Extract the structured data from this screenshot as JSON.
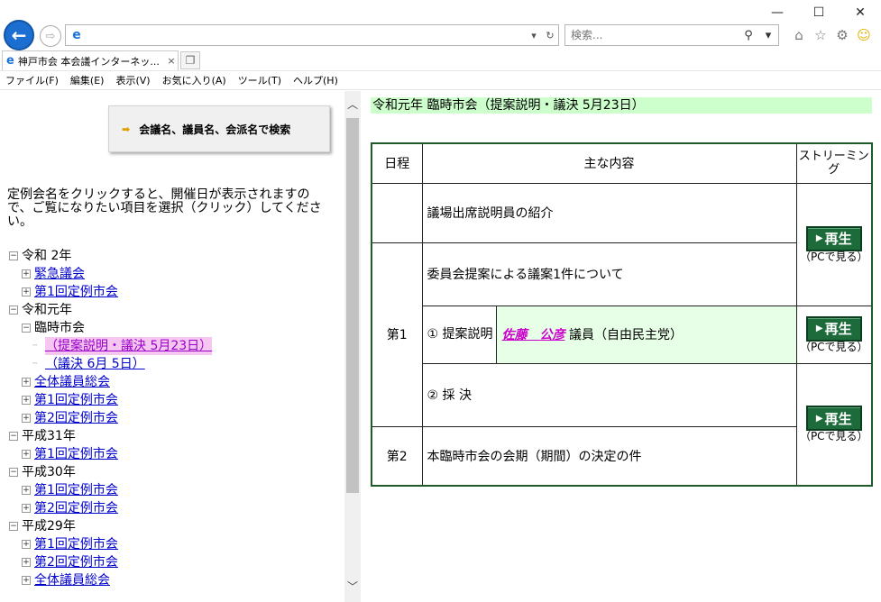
{
  "window": {
    "minimize_glyph": "—",
    "maximize_glyph": "☐",
    "close_glyph": "✕"
  },
  "address": {
    "value": "",
    "refresh_glyph": "↻",
    "dropdown_glyph": "▾"
  },
  "search": {
    "placeholder": "検索..."
  },
  "tab": {
    "title": "神戸市会 本会議インターネッ...",
    "close_glyph": "×"
  },
  "menu": [
    "ファイル(F)",
    "編集(E)",
    "表示(V)",
    "お気に入り(A)",
    "ツール(T)",
    "ヘルプ(H)"
  ],
  "left": {
    "search_button_label": "会議名、議員名、会派名で検索",
    "instruction": "定例会名をクリックすると、開催日が表示されますので、ご覧になりたい項目を選択（クリック）してください。",
    "tree": {
      "r2": {
        "label": "令和 2年",
        "children": [
          "緊急議会",
          "第1回定例市会"
        ]
      },
      "r1": {
        "label": "令和元年",
        "rinji": {
          "label": "臨時市会",
          "items": [
            "（提案説明・議決 5月23日）",
            "（議決 6月 5日）"
          ]
        },
        "others": [
          "全体議員総会",
          "第1回定例市会",
          "第2回定例市会"
        ]
      },
      "h31": {
        "label": "平成31年",
        "children": [
          "第1回定例市会"
        ]
      },
      "h30": {
        "label": "平成30年",
        "children": [
          "第1回定例市会",
          "第2回定例市会"
        ]
      },
      "h29": {
        "label": "平成29年",
        "children": [
          "第1回定例市会",
          "第2回定例市会",
          "全体議員総会"
        ]
      }
    }
  },
  "right": {
    "title": "令和元年 臨時市会（提案説明・議決 5月23日）",
    "headers": {
      "day": "日程",
      "content": "主な内容",
      "stream": "ストリーミング"
    },
    "rows": {
      "intro": "議場出席説明員の紹介",
      "day1": "第1",
      "committee": "委員会提案による議案1件について",
      "proposal": "① 提案説明",
      "speaker_name": "佐藤　公彦",
      "speaker_suffix": "議員（自由民主党）",
      "vote": "② 採 決",
      "day2": "第2",
      "session_period": "本臨時市会の会期（期間）の決定の件"
    },
    "play_label": "再生",
    "pc_label": "（PCで見る）"
  }
}
